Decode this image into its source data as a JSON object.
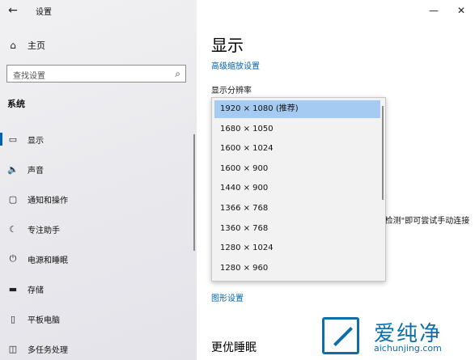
{
  "window": {
    "title": "设置",
    "back_glyph": "←",
    "minimize_glyph": "—",
    "close_glyph": "✕"
  },
  "sidebar": {
    "home_label": "主页",
    "search_placeholder": "查找设置",
    "section_title": "系统",
    "items": [
      {
        "label": "显示",
        "icon": "display-icon",
        "glyph": "▭",
        "active": true
      },
      {
        "label": "声音",
        "icon": "speaker-icon",
        "glyph": "🔈",
        "active": false
      },
      {
        "label": "通知和操作",
        "icon": "notification-icon",
        "glyph": "▢",
        "active": false
      },
      {
        "label": "专注助手",
        "icon": "moon-icon",
        "glyph": "☾",
        "active": false
      },
      {
        "label": "电源和睡眠",
        "icon": "power-icon",
        "glyph": "⏻",
        "active": false
      },
      {
        "label": "存储",
        "icon": "storage-icon",
        "glyph": "▬",
        "active": false
      },
      {
        "label": "平板电脑",
        "icon": "tablet-icon",
        "glyph": "▯",
        "active": false
      },
      {
        "label": "多任务处理",
        "icon": "multitask-icon",
        "glyph": "◫",
        "active": false
      }
    ]
  },
  "main": {
    "page_title": "显示",
    "advanced_scaling_link": "高级缩放设置",
    "resolution_label": "显示分辨率",
    "hint_text": "\"检测\"即可尝试手动连接",
    "graphics_settings_link": "图形设置",
    "sleep_title": "更优睡眠"
  },
  "resolution_dropdown": {
    "selected": "1920 × 1080 (推荐)",
    "options": [
      "1920 × 1080 (推荐)",
      "1680 × 1050",
      "1600 × 1024",
      "1600 × 900",
      "1440 × 900",
      "1366 × 768",
      "1360 × 768",
      "1280 × 1024",
      "1280 × 960"
    ]
  },
  "watermark": {
    "text_cn": "爱纯净",
    "url": "aichunjing.com"
  },
  "colors": {
    "accent": "#0063b1",
    "selection": "#a6cbf2",
    "watermark": "#0d6ea9"
  }
}
